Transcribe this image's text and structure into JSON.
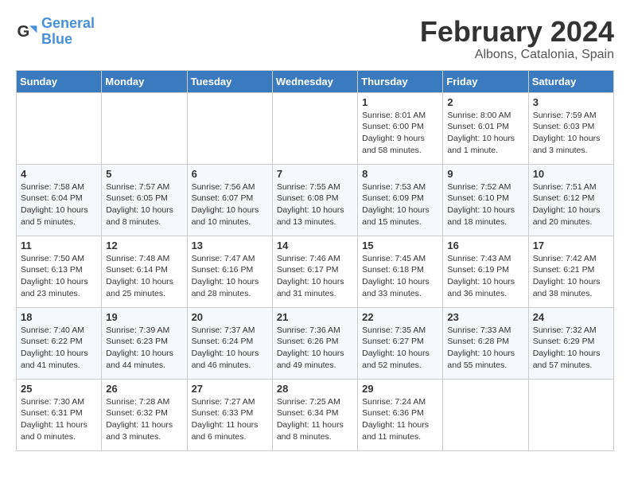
{
  "logo": {
    "text1": "General",
    "text2": "Blue"
  },
  "header": {
    "title": "February 2024",
    "subtitle": "Albons, Catalonia, Spain"
  },
  "weekdays": [
    "Sunday",
    "Monday",
    "Tuesday",
    "Wednesday",
    "Thursday",
    "Friday",
    "Saturday"
  ],
  "weeks": [
    [
      {
        "day": "",
        "info": ""
      },
      {
        "day": "",
        "info": ""
      },
      {
        "day": "",
        "info": ""
      },
      {
        "day": "",
        "info": ""
      },
      {
        "day": "1",
        "info": "Sunrise: 8:01 AM\nSunset: 6:00 PM\nDaylight: 9 hours\nand 58 minutes."
      },
      {
        "day": "2",
        "info": "Sunrise: 8:00 AM\nSunset: 6:01 PM\nDaylight: 10 hours\nand 1 minute."
      },
      {
        "day": "3",
        "info": "Sunrise: 7:59 AM\nSunset: 6:03 PM\nDaylight: 10 hours\nand 3 minutes."
      }
    ],
    [
      {
        "day": "4",
        "info": "Sunrise: 7:58 AM\nSunset: 6:04 PM\nDaylight: 10 hours\nand 5 minutes."
      },
      {
        "day": "5",
        "info": "Sunrise: 7:57 AM\nSunset: 6:05 PM\nDaylight: 10 hours\nand 8 minutes."
      },
      {
        "day": "6",
        "info": "Sunrise: 7:56 AM\nSunset: 6:07 PM\nDaylight: 10 hours\nand 10 minutes."
      },
      {
        "day": "7",
        "info": "Sunrise: 7:55 AM\nSunset: 6:08 PM\nDaylight: 10 hours\nand 13 minutes."
      },
      {
        "day": "8",
        "info": "Sunrise: 7:53 AM\nSunset: 6:09 PM\nDaylight: 10 hours\nand 15 minutes."
      },
      {
        "day": "9",
        "info": "Sunrise: 7:52 AM\nSunset: 6:10 PM\nDaylight: 10 hours\nand 18 minutes."
      },
      {
        "day": "10",
        "info": "Sunrise: 7:51 AM\nSunset: 6:12 PM\nDaylight: 10 hours\nand 20 minutes."
      }
    ],
    [
      {
        "day": "11",
        "info": "Sunrise: 7:50 AM\nSunset: 6:13 PM\nDaylight: 10 hours\nand 23 minutes."
      },
      {
        "day": "12",
        "info": "Sunrise: 7:48 AM\nSunset: 6:14 PM\nDaylight: 10 hours\nand 25 minutes."
      },
      {
        "day": "13",
        "info": "Sunrise: 7:47 AM\nSunset: 6:16 PM\nDaylight: 10 hours\nand 28 minutes."
      },
      {
        "day": "14",
        "info": "Sunrise: 7:46 AM\nSunset: 6:17 PM\nDaylight: 10 hours\nand 31 minutes."
      },
      {
        "day": "15",
        "info": "Sunrise: 7:45 AM\nSunset: 6:18 PM\nDaylight: 10 hours\nand 33 minutes."
      },
      {
        "day": "16",
        "info": "Sunrise: 7:43 AM\nSunset: 6:19 PM\nDaylight: 10 hours\nand 36 minutes."
      },
      {
        "day": "17",
        "info": "Sunrise: 7:42 AM\nSunset: 6:21 PM\nDaylight: 10 hours\nand 38 minutes."
      }
    ],
    [
      {
        "day": "18",
        "info": "Sunrise: 7:40 AM\nSunset: 6:22 PM\nDaylight: 10 hours\nand 41 minutes."
      },
      {
        "day": "19",
        "info": "Sunrise: 7:39 AM\nSunset: 6:23 PM\nDaylight: 10 hours\nand 44 minutes."
      },
      {
        "day": "20",
        "info": "Sunrise: 7:37 AM\nSunset: 6:24 PM\nDaylight: 10 hours\nand 46 minutes."
      },
      {
        "day": "21",
        "info": "Sunrise: 7:36 AM\nSunset: 6:26 PM\nDaylight: 10 hours\nand 49 minutes."
      },
      {
        "day": "22",
        "info": "Sunrise: 7:35 AM\nSunset: 6:27 PM\nDaylight: 10 hours\nand 52 minutes."
      },
      {
        "day": "23",
        "info": "Sunrise: 7:33 AM\nSunset: 6:28 PM\nDaylight: 10 hours\nand 55 minutes."
      },
      {
        "day": "24",
        "info": "Sunrise: 7:32 AM\nSunset: 6:29 PM\nDaylight: 10 hours\nand 57 minutes."
      }
    ],
    [
      {
        "day": "25",
        "info": "Sunrise: 7:30 AM\nSunset: 6:31 PM\nDaylight: 11 hours\nand 0 minutes."
      },
      {
        "day": "26",
        "info": "Sunrise: 7:28 AM\nSunset: 6:32 PM\nDaylight: 11 hours\nand 3 minutes."
      },
      {
        "day": "27",
        "info": "Sunrise: 7:27 AM\nSunset: 6:33 PM\nDaylight: 11 hours\nand 6 minutes."
      },
      {
        "day": "28",
        "info": "Sunrise: 7:25 AM\nSunset: 6:34 PM\nDaylight: 11 hours\nand 8 minutes."
      },
      {
        "day": "29",
        "info": "Sunrise: 7:24 AM\nSunset: 6:36 PM\nDaylight: 11 hours\nand 11 minutes."
      },
      {
        "day": "",
        "info": ""
      },
      {
        "day": "",
        "info": ""
      }
    ]
  ]
}
